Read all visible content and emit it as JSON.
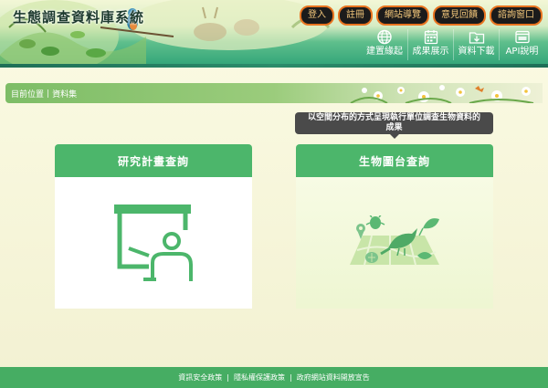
{
  "header": {
    "site_title": "生態調查資料庫系統",
    "top_buttons": [
      "登入",
      "註冊",
      "網站導覽",
      "意見回饋",
      "諮詢窗口"
    ],
    "nav": [
      {
        "label": "建置緣起",
        "icon": "globe-icon"
      },
      {
        "label": "成果展示",
        "icon": "calendar-grid-icon"
      },
      {
        "label": "資料下載",
        "icon": "folder-download-icon"
      },
      {
        "label": "API說明",
        "icon": "api-window-icon"
      }
    ]
  },
  "breadcrumb": {
    "current": "目前位置",
    "separator": "|",
    "page": "資料集"
  },
  "tooltip": {
    "line1": "以空間分布的方式呈現執行單位調查生物資料的",
    "line2": "成果"
  },
  "cards": [
    {
      "title": "研究計畫查詢",
      "icon": "presentation-board-icon"
    },
    {
      "title": "生物圖台查詢",
      "icon": "biodiversity-map-icon"
    }
  ],
  "footer": {
    "links": [
      "資訊安全政策",
      "隱私權保護政策",
      "政府網站資料開放宣告"
    ],
    "separator": "|"
  },
  "colors": {
    "primary_green": "#4cb66b",
    "footer_green": "#46ad63",
    "header_teal": "#2ea377",
    "top_button_bg": "#1b1b1b",
    "top_button_border": "#e8731f"
  }
}
